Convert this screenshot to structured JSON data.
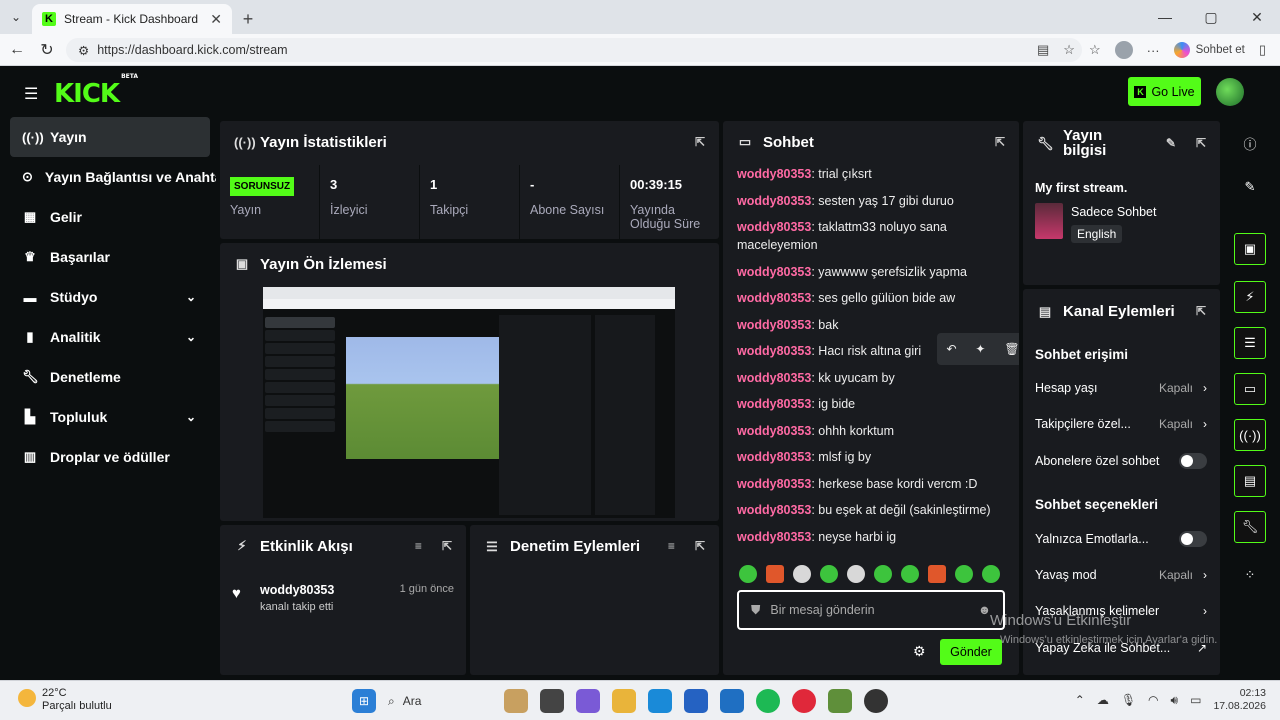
{
  "browser": {
    "tab_title": "Stream - Kick Dashboard",
    "url": "https://dashboard.kick.com/stream",
    "copilot_label": "Sohbet et"
  },
  "app": {
    "logo": "KICK",
    "logo_badge": "BETA",
    "go_live": "Go Live"
  },
  "sidebar": {
    "items": [
      {
        "label": "Yayın",
        "icon": "broadcast-icon"
      },
      {
        "label": "Yayın Bağlantısı ve Anahtarı",
        "icon": "link-icon"
      },
      {
        "label": "Gelir",
        "icon": "revenue-icon"
      },
      {
        "label": "Başarılar",
        "icon": "trophy-icon"
      },
      {
        "label": "Stüdyo",
        "icon": "studio-icon"
      },
      {
        "label": "Analitik",
        "icon": "analytics-icon"
      },
      {
        "label": "Denetleme",
        "icon": "wrench-icon"
      },
      {
        "label": "Topluluk",
        "icon": "community-icon"
      },
      {
        "label": "Droplar ve ödüller",
        "icon": "drops-icon"
      }
    ]
  },
  "stats": {
    "title": "Yayın İstatistikleri",
    "status_badge": "SORUNSUZ",
    "status_label": "Yayın",
    "viewers_value": "3",
    "viewers_label": "İzleyici",
    "followers_value": "1",
    "followers_label": "Takipçi",
    "subs_value": "-",
    "subs_label": "Abone Sayısı",
    "uptime_value": "00:39:15",
    "uptime_label": "Yayında Olduğu Süre"
  },
  "preview": {
    "title": "Yayın Ön İzlemesi"
  },
  "activity": {
    "title": "Etkinlik Akışı",
    "item_user": "woddy80353",
    "item_time": "1 gün önce",
    "item_desc": "kanalı takip etti"
  },
  "moderation": {
    "title": "Denetim Eylemleri"
  },
  "chat": {
    "title": "Sohbet",
    "messages": [
      {
        "user": "woddy80353",
        "text": "trial çıksrt"
      },
      {
        "user": "woddy80353",
        "text": "sesten yaş 17 gibi duruo"
      },
      {
        "user": "woddy80353",
        "text": "taklattm33 noluyo sana maceleyemion"
      },
      {
        "user": "woddy80353",
        "text": "yawwww şerefsizlik yapma"
      },
      {
        "user": "woddy80353",
        "text": "ses gello gülüon bide aw"
      },
      {
        "user": "woddy80353",
        "text": "bak"
      },
      {
        "user": "woddy80353",
        "text": "Hacı risk altına giri"
      },
      {
        "user": "woddy80353",
        "text": "kk uyucam by"
      },
      {
        "user": "woddy80353",
        "text": "ig bide"
      },
      {
        "user": "woddy80353",
        "text": "ohhh korktum"
      },
      {
        "user": "woddy80353",
        "text": "mlsf ig by"
      },
      {
        "user": "woddy80353",
        "text": "herkese base kordi vercm :D"
      },
      {
        "user": "woddy80353",
        "text": "bu eşek at değil (sakinleştirme)"
      },
      {
        "user": "woddy80353",
        "text": "neyse harbi ig"
      }
    ],
    "input_placeholder": "Bir mesaj gönderin",
    "send_label": "Gönder"
  },
  "stream_info": {
    "title": "Yayın bilgisi",
    "stream_title": "My first stream.",
    "category": "Sadece Sohbet",
    "language": "English"
  },
  "channel_actions": {
    "title": "Kanal Eylemleri",
    "chat_access_header": "Sohbet erişimi",
    "account_age": "Hesap yaşı",
    "account_age_state": "Kapalı",
    "followers_only": "Takipçilere özel...",
    "followers_only_state": "Kapalı",
    "subs_only": "Abonelere özel sohbet",
    "chat_options_header": "Sohbet seçenekleri",
    "emotes_only": "Yalnızca Emotlarla...",
    "slow_mode": "Yavaş mod",
    "slow_mode_state": "Kapalı",
    "banned_words": "Yasaklanmış kelimeler",
    "ai_chat": "Yapay Zeka ile Sohbet..."
  },
  "watermark": {
    "line1": "Windows'u Etkinleştir",
    "line2": "Windows'u etkinleştirmek için Ayarlar'a gidin."
  },
  "taskbar": {
    "temp": "22°C",
    "weather": "Parçalı bulutlu",
    "search": "Ara",
    "time": "02:13",
    "date": "17.08.2026"
  },
  "colors": {
    "accent": "#53fc18",
    "username": "#ff6aa4",
    "panel": "#191b1f"
  }
}
